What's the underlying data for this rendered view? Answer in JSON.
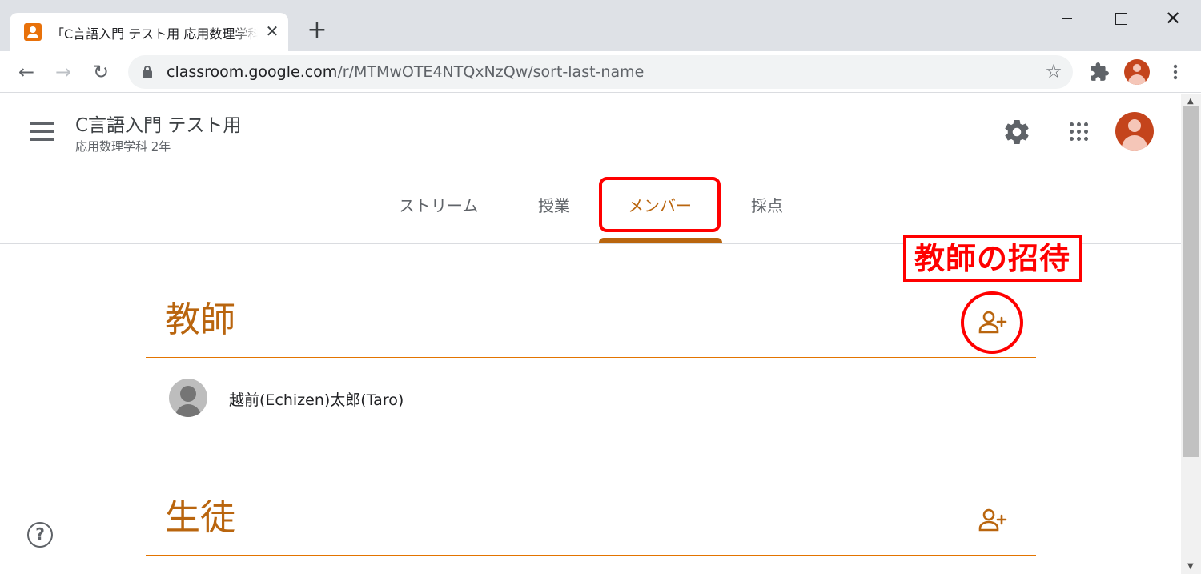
{
  "browser": {
    "tab_title": "「C言語入門 テスト用 応用数理学科",
    "tab_close": "✕",
    "new_tab": "+",
    "window_close": "✕",
    "back": "←",
    "forward": "→",
    "reload": "↻",
    "url_host": "classroom.google.com",
    "url_path": "/r/MTMwOTE4NTQxNzQw/sort-last-name",
    "star": "☆"
  },
  "classroom": {
    "class_title": "C言語入門 テスト用",
    "class_subtitle": "応用数理学科 2年",
    "tabs": {
      "stream": "ストリーム",
      "classwork": "授業",
      "people": "メンバー",
      "grades": "採点"
    },
    "active_tab": "people",
    "accent_color": "#b9650e",
    "teachers": {
      "heading": "教師",
      "members": [
        {
          "name": "越前(Echizen)太郎(Taro)"
        }
      ]
    },
    "students": {
      "heading": "生徒"
    },
    "help": "?"
  },
  "annotation": {
    "label": "教師の招待",
    "color": "#ff0000"
  }
}
